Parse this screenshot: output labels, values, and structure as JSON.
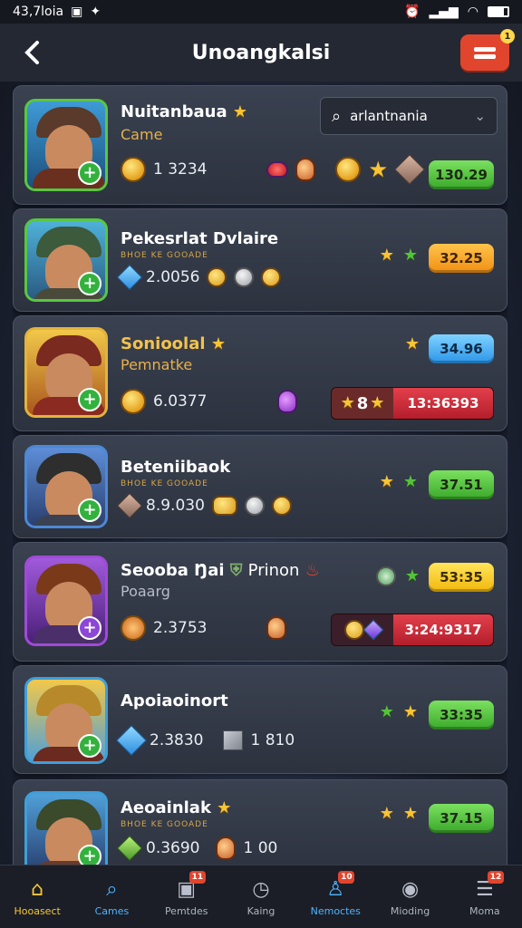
{
  "status_bar": {
    "time": "43,7loia",
    "icons": [
      "alarm-icon",
      "signal-icon",
      "wifi-icon",
      "battery-icon"
    ]
  },
  "header": {
    "title": "Unoangkalsi",
    "back_icon": "back-arrow-icon",
    "menu_badge": "1"
  },
  "dropdown": {
    "value": "arlantnania"
  },
  "games": [
    {
      "name": "Nuitanbaua",
      "subtitle": "Came",
      "amount": "1 3234",
      "price": "130.29",
      "price_color": "green"
    },
    {
      "name": "Pekesrlat Dvlaire",
      "tagline": "BHOE KE GOOADE",
      "amount": "2.0056",
      "price": "32.25",
      "price_color": "orange"
    },
    {
      "name": "Sonioolal",
      "subtitle": "Pemnatke",
      "amount": "6.0377",
      "price": "34.96",
      "price_color": "blue",
      "bar_count": "8",
      "bar_value": "13:36393"
    },
    {
      "name": "Beteniibaok",
      "tagline": "BHOE KE GOOADE",
      "amount": "8.9.030",
      "price": "37.51",
      "price_color": "green"
    },
    {
      "name": "Seooba Ŋai",
      "name_extra": "Prinon",
      "subtitle": "Poaarg",
      "amount": "2.3753",
      "price": "53:35",
      "price_color": "yellow",
      "bar_value": "3:24:9317"
    },
    {
      "name": "Apoiaoinort",
      "amount": "2.3830",
      "amount2": "1 810",
      "price": "33:35",
      "price_color": "green"
    },
    {
      "name": "Aeoainlak",
      "tagline": "BHOE KE GOOADE",
      "amount": "0.3690",
      "amount2": "1 00",
      "price": "37.15",
      "price_color": "green"
    }
  ],
  "nav": [
    {
      "label": "Hooasect",
      "icon": "home-icon",
      "active": true
    },
    {
      "label": "Cames",
      "icon": "search-icon",
      "blue": true
    },
    {
      "label": "Pemtdes",
      "icon": "tv-icon",
      "badge": "11"
    },
    {
      "label": "Kaing",
      "icon": "clock-icon"
    },
    {
      "label": "Nemoctes",
      "icon": "shirt-icon",
      "badge": "10",
      "blue": true
    },
    {
      "label": "Mioding",
      "icon": "gamepad-icon"
    },
    {
      "label": "Moma",
      "icon": "menu-icon",
      "badge": "12"
    }
  ]
}
